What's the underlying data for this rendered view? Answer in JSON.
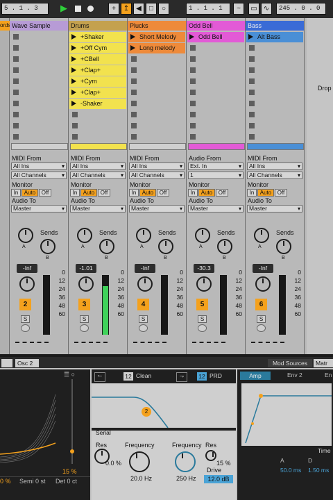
{
  "transport": {
    "arrangement_position": "5 . 1 . 3",
    "song_position": "1 . 1 . 1",
    "loop_length": "245 . 0 . 0"
  },
  "colors": {
    "accent": "#f4a11d",
    "active_play": "#2ed03a",
    "mod_active": "#2a7a9c"
  },
  "tracks": [
    {
      "name": "Wave Sample",
      "color": "#b79bd6",
      "clips": [],
      "clip_color": "",
      "midi_from": "All Ins",
      "channel": "All Channels",
      "audio_from": "",
      "audio_channel": "",
      "volume": "-Inf",
      "number": "2"
    },
    {
      "name": "Drums",
      "color": "#c4a14e",
      "clip_color": "#f2e24e",
      "clips": [
        "+Shaker",
        "+Off Cym",
        "+CBell",
        "+Clap+",
        "+Cym",
        "+Clap+",
        "-Shaker"
      ],
      "midi_from": "All Ins",
      "channel": "All Channels",
      "audio_from": "",
      "audio_channel": "",
      "volume": "-1.01",
      "number": "3"
    },
    {
      "name": "Plucks",
      "color": "#ee8a3a",
      "clip_color": "#ee8a3a",
      "clips": [
        "Short Melody",
        "Long melody"
      ],
      "midi_from": "All Ins",
      "channel": "All Channels",
      "audio_from": "",
      "audio_channel": "",
      "volume": "-Inf",
      "number": "4"
    },
    {
      "name": "Odd Bell",
      "color": "#e25ad6",
      "clip_color": "#e25ad6",
      "clips": [
        "Odd Bell"
      ],
      "midi_from": "",
      "channel": "",
      "audio_from": "Ext. In",
      "audio_channel": "1",
      "volume": "-30.3",
      "number": "5"
    },
    {
      "name": "Bass",
      "color": "#3a6bd6",
      "clip_color": "#4a8fd6",
      "clips": [
        "Alt Bass"
      ],
      "midi_from": "All Ins",
      "channel": "All Channels",
      "audio_from": "",
      "audio_channel": "",
      "volume": "-Inf",
      "number": "6"
    }
  ],
  "labels": {
    "midi_from": "MIDI From",
    "audio_from": "Audio From",
    "monitor": "Monitor",
    "audio_to": "Audio To",
    "audio_to_value": "Master",
    "sends": "Sends",
    "send_a": "A",
    "send_b": "B",
    "mon_in": "In",
    "mon_auto": "Auto",
    "mon_off": "Off",
    "solo": "S",
    "drop": "Drop",
    "partial_name": "ords"
  },
  "meter_scale": [
    "0",
    "12",
    "24",
    "36",
    "48",
    "60"
  ],
  "device": {
    "tabs": [
      "Osc 2"
    ],
    "right_tabs": [
      "Mod Sources",
      "Matr"
    ],
    "filter_count": "12",
    "filter_type": "Clean",
    "filter2_count": "12",
    "filter2_type": "PRD",
    "routing": "Serial",
    "osc_pct": "15 %",
    "osc_left": "0 %",
    "semi": "Semi 0 st",
    "det": "Det 0 ct",
    "res_label": "Res",
    "res_value": "0.0 %",
    "freq_label": "Frequency",
    "freq_value": "20.0 Hz",
    "freq2_label": "Frequency",
    "res2_label": "Res",
    "freq2_value": "250 Hz",
    "res2_value": "15 %",
    "drive_label": "Drive",
    "drive_value": "12.0 dB",
    "badge": "2",
    "mod_tabs": [
      "Amp",
      "Env 2",
      "En"
    ],
    "time_label": "Time",
    "a_label": "A",
    "d_label": "D",
    "a_value": "50.0 ms",
    "d_value": "1.50 ms"
  }
}
